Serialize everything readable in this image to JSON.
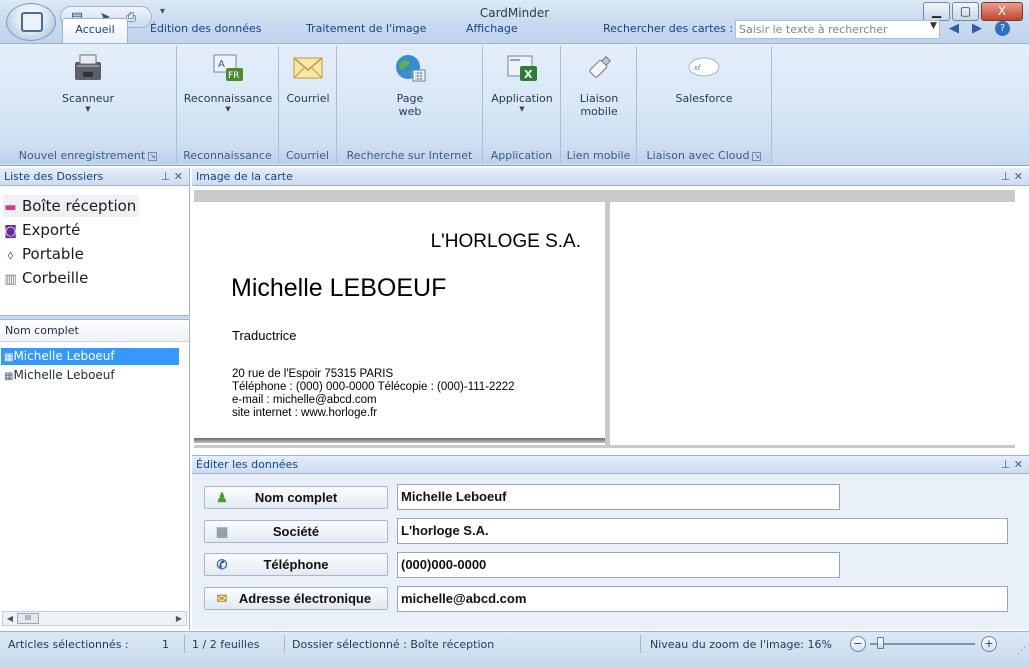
{
  "window": {
    "title": "CardMinder",
    "minimize": "▁",
    "maximize": "▢",
    "close": "X"
  },
  "tabs": [
    "Accueil",
    "Édition des données",
    "Traitement de l'image",
    "Affichage"
  ],
  "search": {
    "label": "Rechercher des cartes :",
    "placeholder": "Saisir le texte à rechercher"
  },
  "ribbon": {
    "groups": [
      {
        "label": "Nouvel enregistrement",
        "buttons": [
          {
            "label": "Scanneur",
            "icon": "scanner-icon"
          }
        ]
      },
      {
        "label": "Reconnaissance",
        "buttons": [
          {
            "label": "Reconnaissance",
            "icon": "ocr-fr-icon"
          }
        ]
      },
      {
        "label": "Courriel",
        "buttons": [
          {
            "label": "Courriel",
            "icon": "envelope-icon"
          }
        ]
      },
      {
        "label": "Recherche sur Internet",
        "buttons": [
          {
            "label": "Page",
            "label2": "web",
            "icon": "globe-icon"
          }
        ]
      },
      {
        "label": "Application",
        "buttons": [
          {
            "label": "Application",
            "icon": "excel-icon"
          }
        ]
      },
      {
        "label": "Lien mobile",
        "buttons": [
          {
            "label": "Liaison",
            "label2": "mobile",
            "icon": "usb-icon"
          }
        ]
      },
      {
        "label": "Liaison avec Cloud",
        "buttons": [
          {
            "label": "Salesforce",
            "icon": "salesforce-icon"
          }
        ]
      }
    ]
  },
  "folders": {
    "header": "Liste des Dossiers",
    "items": [
      "Boîte réception",
      "Exporté",
      "Portable",
      "Corbeille"
    ]
  },
  "names": {
    "header": "Nom complet",
    "items": [
      "Michelle Leboeuf",
      "Michelle Leboeuf"
    ]
  },
  "card_image": {
    "header": "Image de la carte",
    "company": "L'HORLOGE S.A.",
    "name": "Michelle LEBOEUF",
    "job": "Traductrice",
    "lines": [
      "20 rue de l'Espoir 75315 PARIS",
      "Téléphone : (000) 000-0000    Télécopie : (000)-111-2222",
      "e-mail : michelle@abcd.com",
      "site internet : www.horloge.fr"
    ]
  },
  "edit": {
    "header": "Éditer les données",
    "fields": [
      {
        "label": "Nom complet",
        "value": "Michelle Leboeuf",
        "icon": "person-icon"
      },
      {
        "label": "Société",
        "value": "L'horloge S.A.",
        "icon": "building-icon"
      },
      {
        "label": "Téléphone",
        "value": "(000)000-0000",
        "icon": "phone-icon"
      },
      {
        "label": "Adresse électronique",
        "value": "michelle@abcd.com",
        "icon": "envelope-icon"
      }
    ]
  },
  "status": {
    "selected": "Articles sélectionnés :",
    "selected_count": "1",
    "pages": "1 /   2 feuilles",
    "folder": "Dossier sélectionné : Boîte réception",
    "zoom": "Niveau du zoom de l'image:  16%",
    "zoom_level": 0.16
  }
}
